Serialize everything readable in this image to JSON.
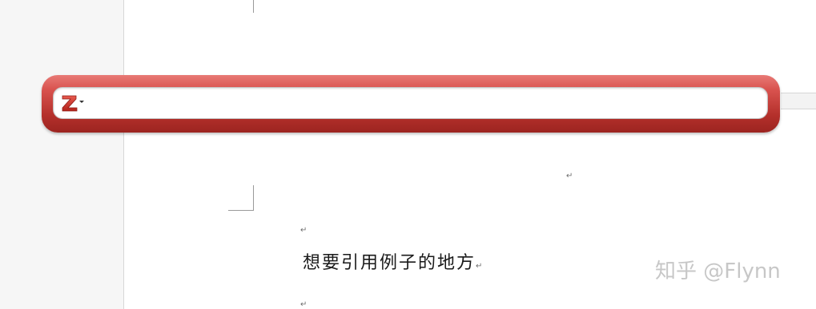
{
  "zotero_bar": {
    "logo_letter": "Z",
    "search_value": "",
    "brand_colors": {
      "bar": "#c0392b",
      "logo": "#d32f2f"
    }
  },
  "document": {
    "paragraph_mark": "↵",
    "main_text": "想要引用例子的地方",
    "text_paragraph_mark": "↵"
  },
  "watermark": {
    "text": "知乎 @Flynn"
  }
}
